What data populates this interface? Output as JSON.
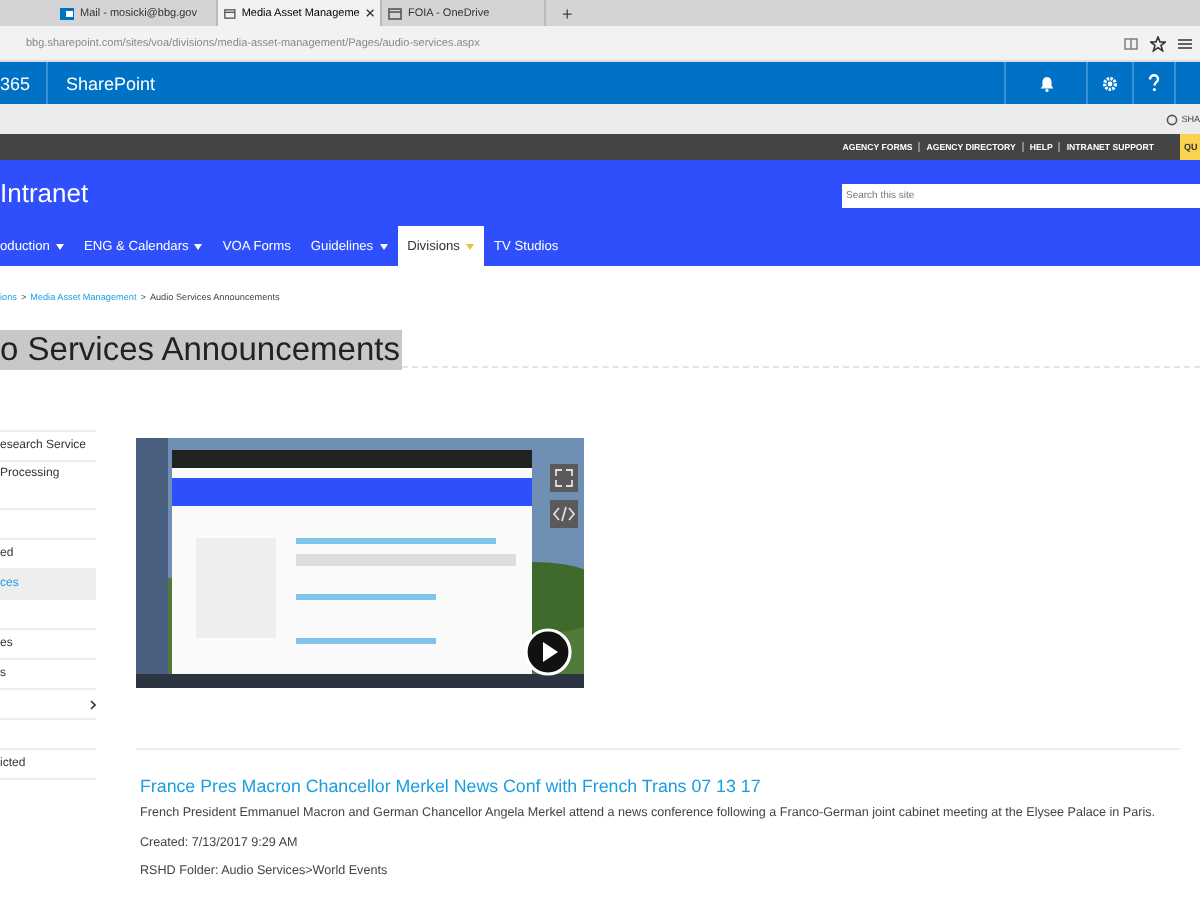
{
  "browser": {
    "tabs": [
      {
        "label": "Mail - mosicki@bbg.gov",
        "selected": false,
        "kind": "mail"
      },
      {
        "label": "Media Asset Manageme",
        "selected": true,
        "kind": "page"
      },
      {
        "label": "FOIA - OneDrive",
        "selected": false,
        "kind": "page"
      }
    ],
    "new_tab": "+",
    "address": "bbg.sharepoint.com/sites/voa/divisions/media-asset-management/Pages/audio-services.aspx"
  },
  "suite_bar": {
    "prefix": "365",
    "title": "SharePoint"
  },
  "notice_bar": {
    "label": "SHA"
  },
  "agency_links": [
    "AGENCY FORMS",
    "AGENCY DIRECTORY",
    "HELP",
    "INTRANET SUPPORT"
  ],
  "quick_button": "QU",
  "site": {
    "title": "Intranet",
    "search": {
      "placeholder": "Search this site"
    }
  },
  "nav": [
    {
      "label": "oduction",
      "dropdown": true,
      "selected": false
    },
    {
      "label": "ENG & Calendars",
      "dropdown": true,
      "selected": false
    },
    {
      "label": "VOA Forms",
      "dropdown": false,
      "selected": false
    },
    {
      "label": "Guidelines",
      "dropdown": true,
      "selected": false
    },
    {
      "label": "Divisions",
      "dropdown": true,
      "selected": true
    },
    {
      "label": "TV Studios",
      "dropdown": false,
      "selected": false
    }
  ],
  "breadcrumb": {
    "separator": ">",
    "items": [
      {
        "label": "ions",
        "link": true
      },
      {
        "label": "Media Asset Management",
        "link": true
      },
      {
        "label": "Audio Services Announcements",
        "link": false
      }
    ]
  },
  "page_title": "o Services Announcements",
  "left_nav": [
    {
      "label": "esearch Service",
      "selected": false,
      "has_children": false
    },
    {
      "label": "Processing",
      "selected": false,
      "has_children": false
    },
    {
      "selected": false,
      "has_children": false
    },
    {
      "label": "ed",
      "selected": false,
      "has_children": false
    },
    {
      "label": "ces",
      "selected": true,
      "has_children": false
    },
    {
      "selected": false,
      "has_children": false
    },
    {
      "label": "es",
      "selected": false,
      "has_children": false
    },
    {
      "label": "s",
      "selected": false,
      "has_children": false
    },
    {
      "selected": false,
      "has_children": true
    },
    {
      "selected": false,
      "has_children": false
    },
    {
      "label": "icted",
      "selected": false,
      "has_children": false
    }
  ],
  "announcement": {
    "title": "France Pres Macron Chancellor Merkel News Conf with French Trans 07 13 17",
    "description": "French President Emmanuel Macron and German Chancellor Angela Merkel attend a news conference following a Franco-German joint cabinet meeting at the Elysee Palace in Paris.",
    "created": "Created: 7/13/2017 9:29 AM",
    "folder": "RSHD Folder: Audio Services>World Events"
  }
}
